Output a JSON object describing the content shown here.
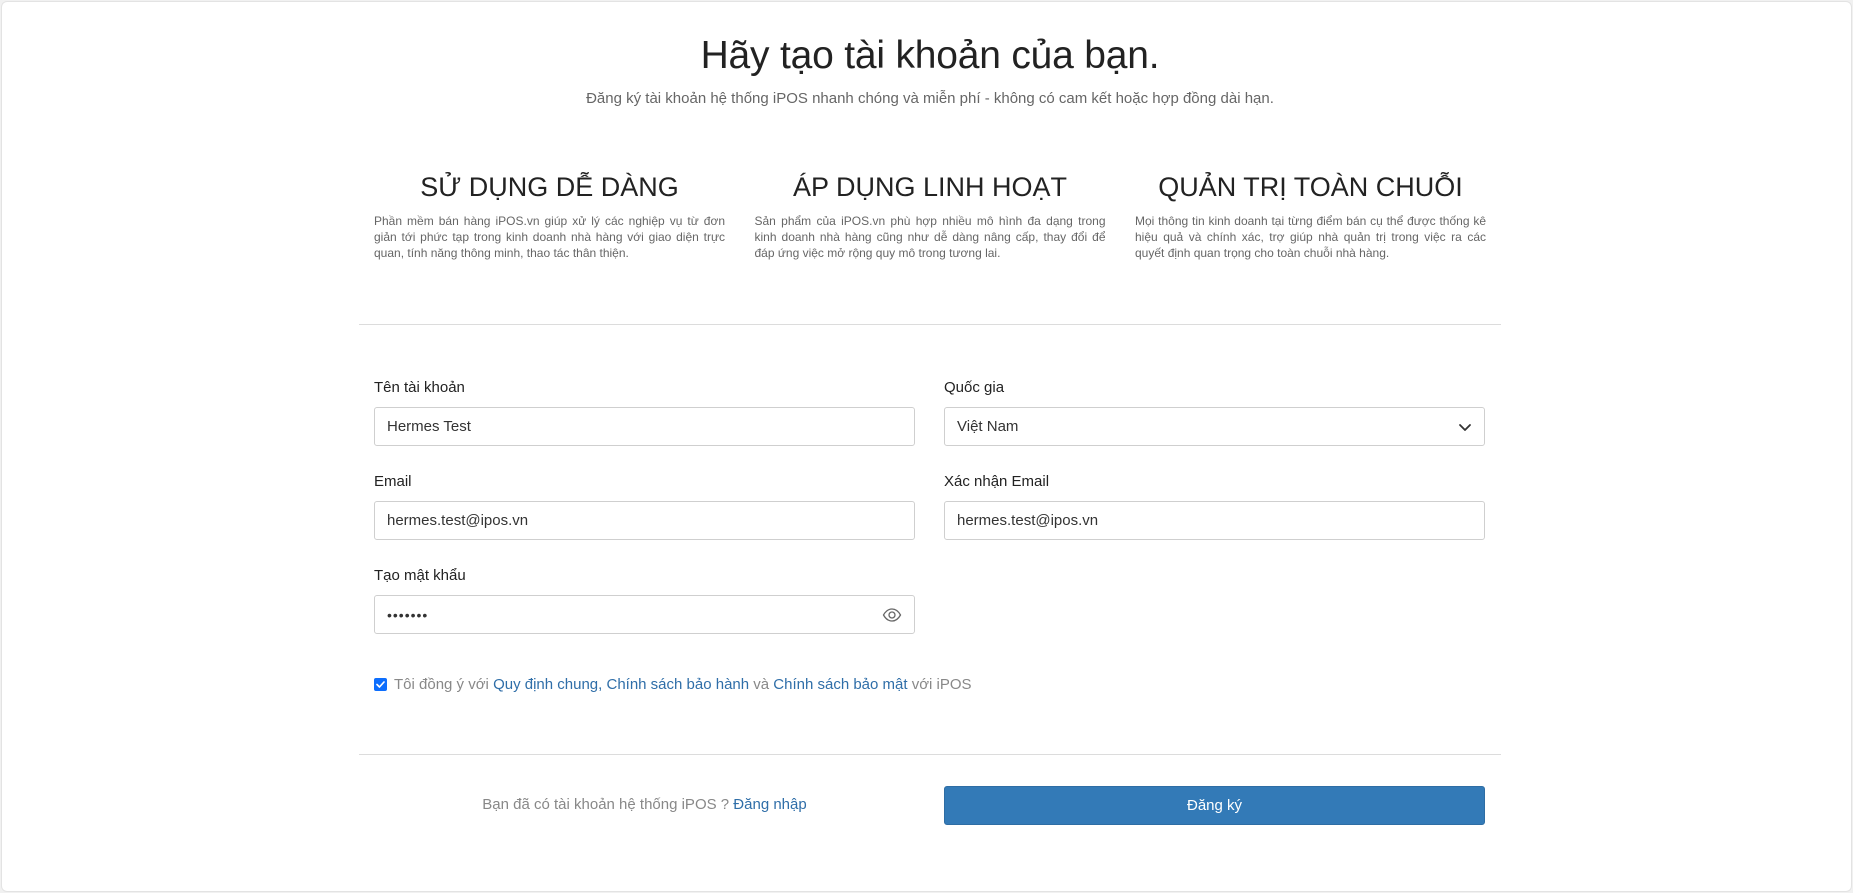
{
  "header": {
    "title": "Hãy tạo tài khoản của bạn.",
    "subtitle": "Đăng ký tài khoản hệ thống iPOS nhanh chóng và miễn phí - không có cam kết hoặc hợp đồng dài hạn."
  },
  "features": [
    {
      "title": "SỬ DỤNG DỄ DÀNG",
      "text": "Phần mềm bán hàng iPOS.vn giúp xử lý các nghiệp vụ từ đơn giản tới phức tạp trong kinh doanh nhà hàng với giao diện trực quan, tính năng thông minh, thao tác thân thiện."
    },
    {
      "title": "ÁP DỤNG LINH HOẠT",
      "text": "Sản phẩm của iPOS.vn phù hợp nhiều mô hình đa dạng trong kinh doanh nhà hàng cũng như dễ dàng nâng cấp, thay đổi để đáp ứng việc mở rộng quy mô trong tương lai."
    },
    {
      "title": "QUẢN TRỊ TOÀN CHUỖI",
      "text": "Mọi thông tin kinh doanh tại từng điểm bán cụ thể được thống kê hiệu quả và chính xác, trợ giúp nhà quản trị trong việc ra các quyết định quan trọng cho toàn chuỗi nhà hàng."
    }
  ],
  "form": {
    "account_name": {
      "label": "Tên tài khoản",
      "value": "Hermes Test"
    },
    "country": {
      "label": "Quốc gia",
      "value": "Việt Nam"
    },
    "email": {
      "label": "Email",
      "value": "hermes.test@ipos.vn"
    },
    "confirm_email": {
      "label": "Xác nhận Email",
      "value": "hermes.test@ipos.vn"
    },
    "password": {
      "label": "Tạo mật khẩu",
      "value": "•••••••"
    }
  },
  "agreement": {
    "checked": true,
    "prefix": "Tôi đồng ý với",
    "link_general": "Quy định chung",
    "comma": ",",
    "link_warranty": "Chính sách bảo hành",
    "and": "và",
    "link_privacy": "Chính sách bảo mật",
    "suffix": "với iPOS"
  },
  "footer": {
    "have_account": "Bạn đã có tài khoản hệ thống iPOS ?",
    "login_link": "Đăng nhập",
    "submit_label": "Đăng ký"
  },
  "colors": {
    "primary": "#337ab7",
    "link": "#2f6ea8",
    "checkbox": "#0d6efd"
  }
}
